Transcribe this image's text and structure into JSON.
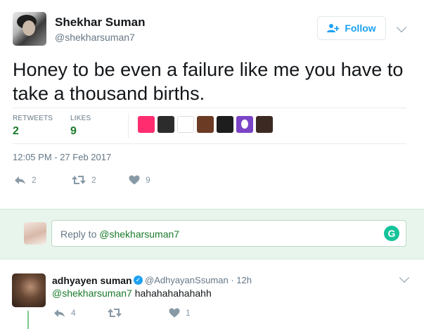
{
  "tweet": {
    "author_name": "Shekhar Suman",
    "author_handle": "@shekharsuman7",
    "follow_label": "Follow",
    "text": "Honey to be even a failure like me you have to take a thousand births.",
    "stats": {
      "retweets_label": "RETWEETS",
      "retweets_value": "2",
      "likes_label": "LIKES",
      "likes_value": "9"
    },
    "liker_colors": [
      "#ff2d6f",
      "#2c2c2c",
      "#dedede",
      "#6b3b24",
      "#1d1d1d",
      "#7b44c6",
      "#3c2a22"
    ],
    "timestamp": "12:05 PM - 27 Feb 2017",
    "actions": {
      "reply_count": "2",
      "retweet_count": "2",
      "like_count": "9"
    }
  },
  "reply_box": {
    "placeholder_prefix": "Reply to ",
    "placeholder_mention": "@shekharsuman7",
    "grammarly_letter": "G"
  },
  "reply_tweet": {
    "author_name": "adhyayen suman",
    "author_handle": "@AdhyayanSsuman",
    "time": "· 12h",
    "mention": "@shekharsuman7",
    "text": " hahahahahahahh",
    "actions": {
      "reply_count": "4",
      "retweet_count": "",
      "like_count": "1"
    }
  },
  "colors": {
    "accent_green": "#1a7a2b",
    "follow_blue": "#1da1f2",
    "reply_bg": "#e8f5ec"
  }
}
